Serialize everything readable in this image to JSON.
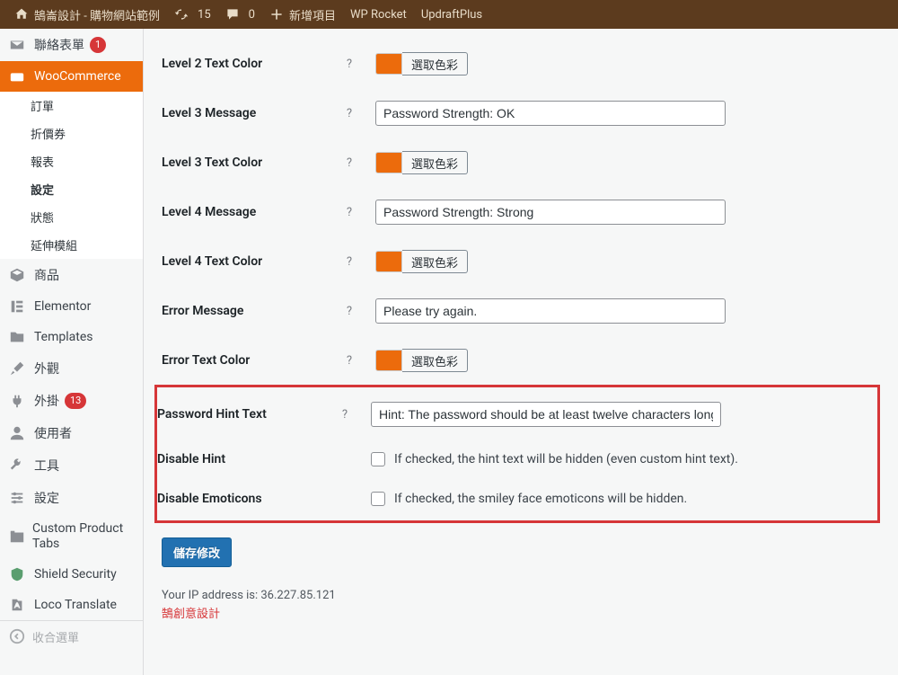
{
  "adminbar": {
    "site_name": "鵠崙設計 - 購物網站範例",
    "updates_count": "15",
    "comments_count": "0",
    "new_item": "新增項目",
    "wp_rocket": "WP Rocket",
    "updraft": "UpdraftPlus"
  },
  "sidebar": {
    "contact_form": {
      "label": "聯絡表單",
      "badge": "1"
    },
    "woocommerce": {
      "label": "WooCommerce"
    },
    "woo_sub": {
      "orders": "訂單",
      "coupons": "折價券",
      "reports": "報表",
      "settings": "設定",
      "status": "狀態",
      "extensions": "延伸模組"
    },
    "products": "商品",
    "elementor": "Elementor",
    "templates": "Templates",
    "appearance": "外觀",
    "plugins": {
      "label": "外掛",
      "badge": "13"
    },
    "users": "使用者",
    "tools": "工具",
    "settings": "設定",
    "custom_product_tabs": "Custom Product Tabs",
    "shield": "Shield Security",
    "loco": "Loco Translate",
    "collapse": "收合選單"
  },
  "form": {
    "select_color": "選取色彩",
    "level2_text_color": {
      "label": "Level 2 Text Color"
    },
    "level3_message": {
      "label": "Level 3 Message",
      "value": "Password Strength: OK"
    },
    "level3_text_color": {
      "label": "Level 3 Text Color"
    },
    "level4_message": {
      "label": "Level 4 Message",
      "value": "Password Strength: Strong"
    },
    "level4_text_color": {
      "label": "Level 4 Text Color"
    },
    "error_message": {
      "label": "Error Message",
      "value": "Please try again."
    },
    "error_text_color": {
      "label": "Error Text Color"
    },
    "password_hint": {
      "label": "Password Hint Text",
      "value": "Hint: The password should be at least twelve characters long."
    },
    "disable_hint": {
      "label": "Disable Hint",
      "desc": "If checked, the hint text will be hidden (even custom hint text)."
    },
    "disable_emoticons": {
      "label": "Disable Emoticons",
      "desc": "If checked, the smiley face emoticons will be hidden."
    }
  },
  "save_button": "儲存修改",
  "footer": {
    "ip_text": "Your IP address is: 36.227.85.121",
    "credit": "鵠創意設計"
  }
}
